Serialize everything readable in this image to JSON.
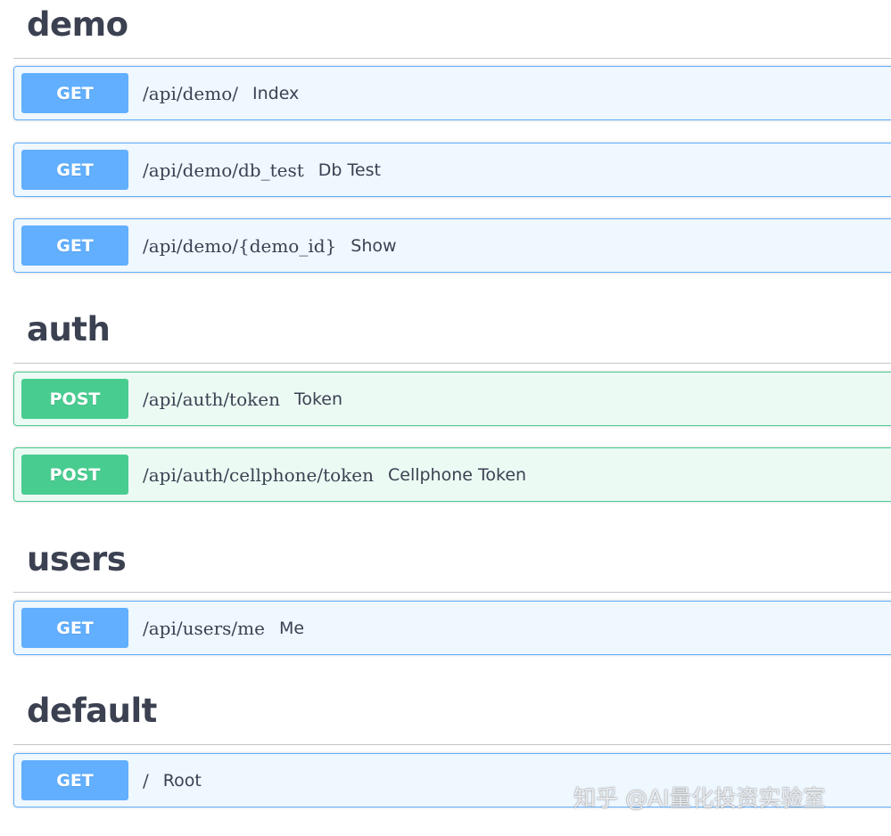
{
  "sections": [
    {
      "title": "demo",
      "operations": [
        {
          "method": "GET",
          "path": "/api/demo/",
          "summary": "Index"
        },
        {
          "method": "GET",
          "path": "/api/demo/db_test",
          "summary": "Db Test"
        },
        {
          "method": "GET",
          "path": "/api/demo/{demo_id}",
          "summary": "Show"
        }
      ]
    },
    {
      "title": "auth",
      "operations": [
        {
          "method": "POST",
          "path": "/api/auth/token",
          "summary": "Token"
        },
        {
          "method": "POST",
          "path": "/api/auth/cellphone/token",
          "summary": "Cellphone Token"
        }
      ]
    },
    {
      "title": "users",
      "operations": [
        {
          "method": "GET",
          "path": "/api/users/me",
          "summary": "Me"
        }
      ]
    },
    {
      "title": "default",
      "operations": [
        {
          "method": "GET",
          "path": "/",
          "summary": "Root"
        }
      ]
    }
  ],
  "colors": {
    "get": "#61affe",
    "post": "#49cc90",
    "heading_text": "#3b4151"
  },
  "watermark": "知乎 @AI量化投资实验室"
}
